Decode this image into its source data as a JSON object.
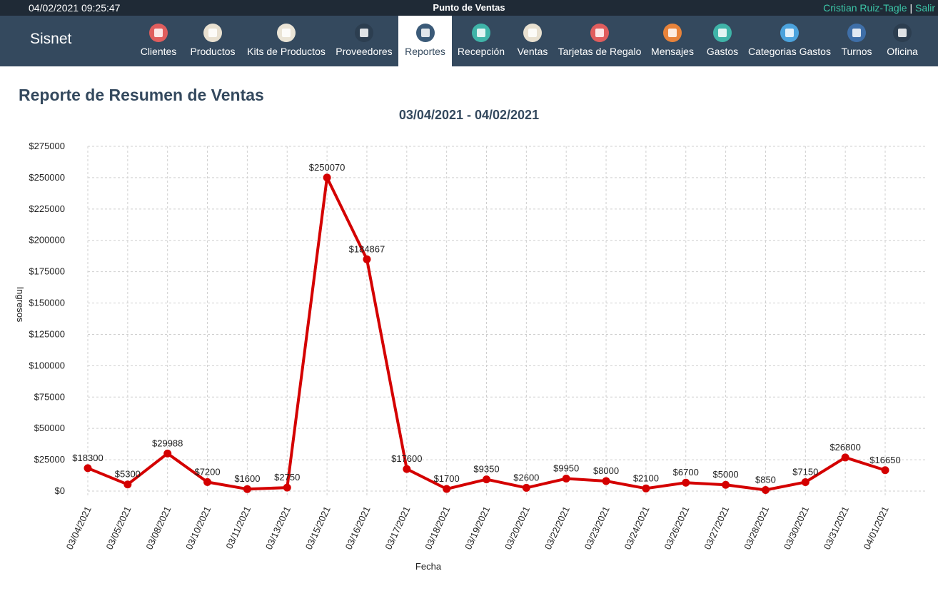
{
  "topbar": {
    "datetime": "04/02/2021 09:25:47",
    "title": "Punto de Ventas",
    "user": "Cristian Ruiz-Tagle",
    "separator": "|",
    "logout": "Salir"
  },
  "brand": "Sisnet",
  "nav": [
    {
      "label": "Clientes",
      "icon": "clients-icon",
      "color": "#e05d5d"
    },
    {
      "label": "Productos",
      "icon": "tag-icon",
      "color": "#e8e0d0"
    },
    {
      "label": "Kits de Productos",
      "icon": "stack-icon",
      "color": "#eae4d6"
    },
    {
      "label": "Proveedores",
      "icon": "briefcase-icon",
      "color": "#2c3e50"
    },
    {
      "label": "Reportes",
      "icon": "bar-chart-icon",
      "color": "#3b5a78",
      "active": true
    },
    {
      "label": "Recepción",
      "icon": "reception-icon",
      "color": "#3fb4a8"
    },
    {
      "label": "Ventas",
      "icon": "basket-icon",
      "color": "#e8e0d0"
    },
    {
      "label": "Tarjetas de Regalo",
      "icon": "heart-icon",
      "color": "#e05d5d"
    },
    {
      "label": "Mensajes",
      "icon": "phone-icon",
      "color": "#e8833a"
    },
    {
      "label": "Gastos",
      "icon": "pencil-icon",
      "color": "#3fb4a8"
    },
    {
      "label": "Categorias Gastos",
      "icon": "clipboard-icon",
      "color": "#4ca3dd"
    },
    {
      "label": "Turnos",
      "icon": "books-icon",
      "color": "#3f6fa8"
    },
    {
      "label": "Oficina",
      "icon": "door-icon",
      "color": "#2c3e50"
    }
  ],
  "page_title": "Reporte de Resumen de Ventas",
  "chart_data": {
    "type": "line",
    "title": "03/04/2021 - 04/02/2021",
    "xlabel": "Fecha",
    "ylabel": "Ingresos",
    "ylim": [
      0,
      275000
    ],
    "ystep": 25000,
    "grid": true,
    "color": "#d40000",
    "x": [
      "03/04/2021",
      "03/05/2021",
      "03/08/2021",
      "03/10/2021",
      "03/11/2021",
      "03/13/2021",
      "03/15/2021",
      "03/16/2021",
      "03/17/2021",
      "03/18/2021",
      "03/19/2021",
      "03/20/2021",
      "03/22/2021",
      "03/23/2021",
      "03/24/2021",
      "03/26/2021",
      "03/27/2021",
      "03/28/2021",
      "03/30/2021",
      "03/31/2021",
      "04/01/2021"
    ],
    "values": [
      18300,
      5300,
      29988,
      7200,
      1600,
      2750,
      250070,
      184867,
      17600,
      1700,
      9350,
      2600,
      9950,
      8000,
      2100,
      6700,
      5000,
      850,
      7150,
      26800,
      16650
    ]
  }
}
